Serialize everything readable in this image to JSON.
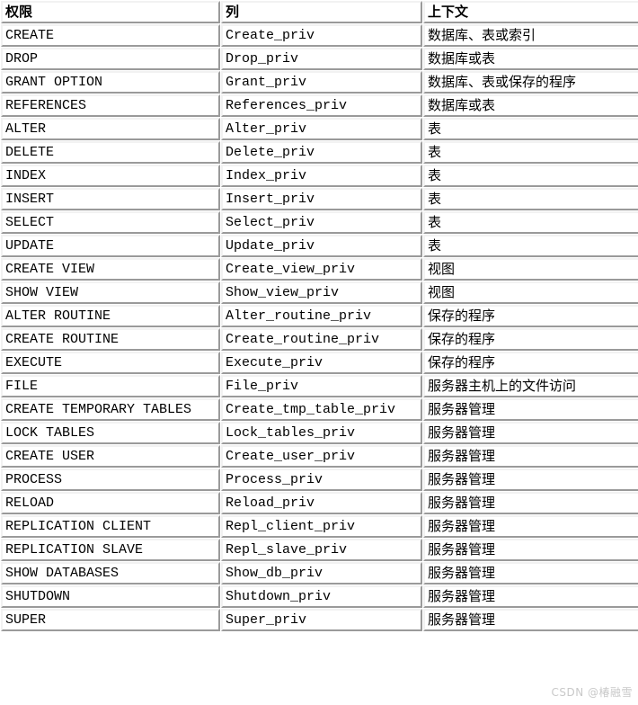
{
  "table": {
    "headers": [
      "权限",
      "列",
      "上下文"
    ],
    "rows": [
      {
        "privilege": "CREATE",
        "column": "Create_priv",
        "context": "数据库、表或索引"
      },
      {
        "privilege": "DROP",
        "column": "Drop_priv",
        "context": "数据库或表"
      },
      {
        "privilege": "GRANT OPTION",
        "column": "Grant_priv",
        "context": "数据库、表或保存的程序"
      },
      {
        "privilege": "REFERENCES",
        "column": "References_priv",
        "context": "数据库或表"
      },
      {
        "privilege": "ALTER",
        "column": "Alter_priv",
        "context": "表"
      },
      {
        "privilege": "DELETE",
        "column": "Delete_priv",
        "context": "表"
      },
      {
        "privilege": "INDEX",
        "column": "Index_priv",
        "context": "表"
      },
      {
        "privilege": "INSERT",
        "column": "Insert_priv",
        "context": "表"
      },
      {
        "privilege": "SELECT",
        "column": "Select_priv",
        "context": "表"
      },
      {
        "privilege": "UPDATE",
        "column": "Update_priv",
        "context": "表"
      },
      {
        "privilege": "CREATE VIEW",
        "column": "Create_view_priv",
        "context": "视图"
      },
      {
        "privilege": "SHOW VIEW",
        "column": "Show_view_priv",
        "context": "视图"
      },
      {
        "privilege": "ALTER ROUTINE",
        "column": "Alter_routine_priv",
        "context": "保存的程序"
      },
      {
        "privilege": "CREATE ROUTINE",
        "column": "Create_routine_priv",
        "context": "保存的程序"
      },
      {
        "privilege": "EXECUTE",
        "column": "Execute_priv",
        "context": "保存的程序"
      },
      {
        "privilege": "FILE",
        "column": "File_priv",
        "context": "服务器主机上的文件访问"
      },
      {
        "privilege": "CREATE TEMPORARY TABLES",
        "column": "Create_tmp_table_priv",
        "context": "服务器管理"
      },
      {
        "privilege": "LOCK TABLES",
        "column": "Lock_tables_priv",
        "context": "服务器管理"
      },
      {
        "privilege": "CREATE USER",
        "column": "Create_user_priv",
        "context": "服务器管理"
      },
      {
        "privilege": "PROCESS",
        "column": "Process_priv",
        "context": "服务器管理"
      },
      {
        "privilege": "RELOAD",
        "column": "Reload_priv",
        "context": "服务器管理"
      },
      {
        "privilege": "REPLICATION CLIENT",
        "column": "Repl_client_priv",
        "context": "服务器管理"
      },
      {
        "privilege": "REPLICATION SLAVE",
        "column": "Repl_slave_priv",
        "context": "服务器管理"
      },
      {
        "privilege": "SHOW DATABASES",
        "column": "Show_db_priv",
        "context": "服务器管理"
      },
      {
        "privilege": "SHUTDOWN",
        "column": "Shutdown_priv",
        "context": "服务器管理"
      },
      {
        "privilege": "SUPER",
        "column": "Super_priv",
        "context": "服务器管理"
      }
    ]
  },
  "watermark": {
    "text": "CSDN @椿融雪",
    "color": "#c9c9c9"
  },
  "colors": {
    "background": "#ffffff",
    "text": "#000000",
    "border_dark": "#9a9a9a",
    "border_light": "#f2f2f2"
  }
}
